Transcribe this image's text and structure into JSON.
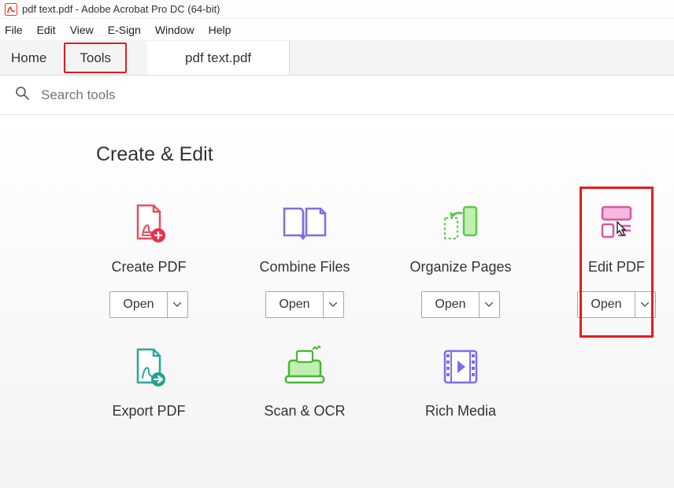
{
  "window": {
    "title": "pdf text.pdf - Adobe Acrobat Pro DC (64-bit)"
  },
  "menu": {
    "items": [
      "File",
      "Edit",
      "View",
      "E-Sign",
      "Window",
      "Help"
    ]
  },
  "tabs": {
    "home": "Home",
    "tools": "Tools",
    "document": "pdf text.pdf"
  },
  "search": {
    "placeholder": "Search tools"
  },
  "section": {
    "title": "Create & Edit"
  },
  "tools": {
    "open_label": "Open",
    "items": [
      {
        "label": "Create PDF"
      },
      {
        "label": "Combine Files"
      },
      {
        "label": "Organize Pages"
      },
      {
        "label": "Edit PDF"
      },
      {
        "label": "Export PDF"
      },
      {
        "label": "Scan & OCR"
      },
      {
        "label": "Rich Media"
      }
    ]
  }
}
